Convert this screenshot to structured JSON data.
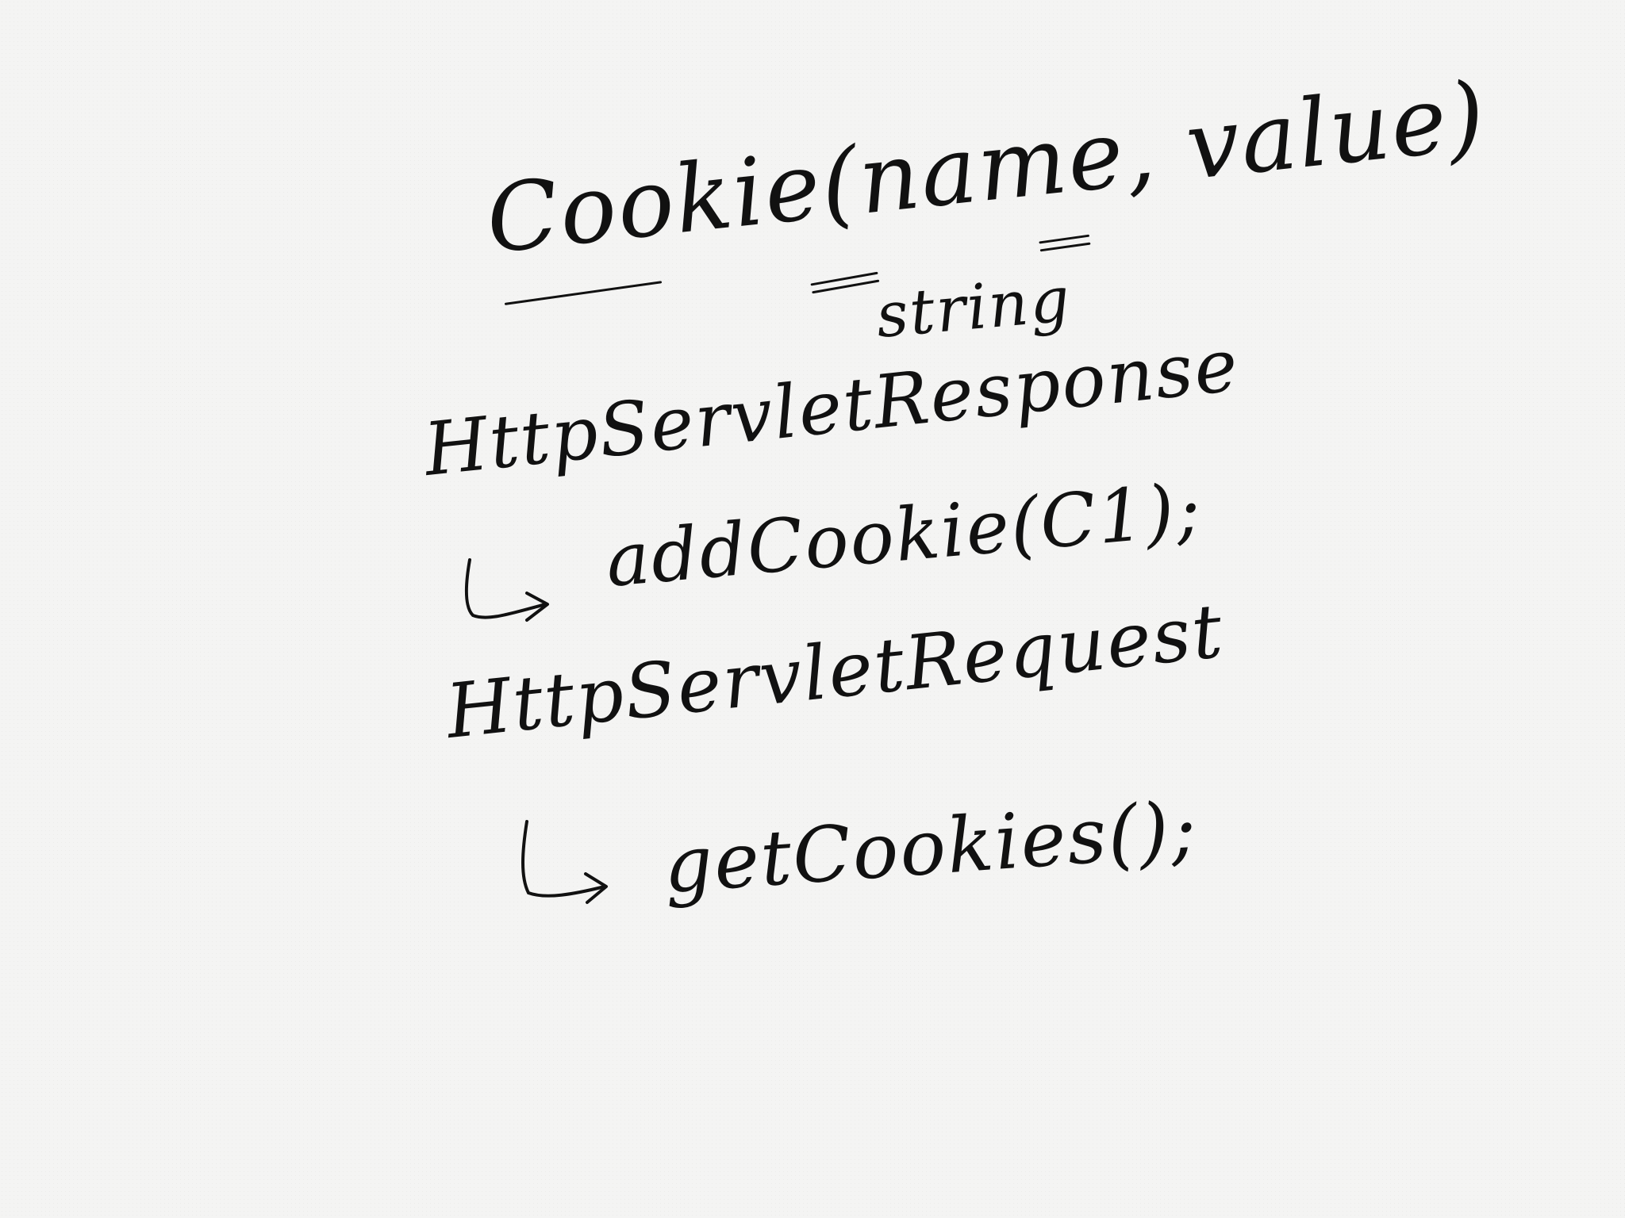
{
  "lines": {
    "cookie_constructor": "Cookie(name, value)",
    "string_annotation": "string",
    "response_class": "HttpServletResponse",
    "add_cookie_call": "addCookie(C1);",
    "request_class": "HttpServletRequest",
    "get_cookies_call": "getCookies();"
  },
  "ink_color": "#111111",
  "paper_color": "#f4f4f3",
  "icons": {
    "arrow": "hooked-right-arrow-icon"
  }
}
